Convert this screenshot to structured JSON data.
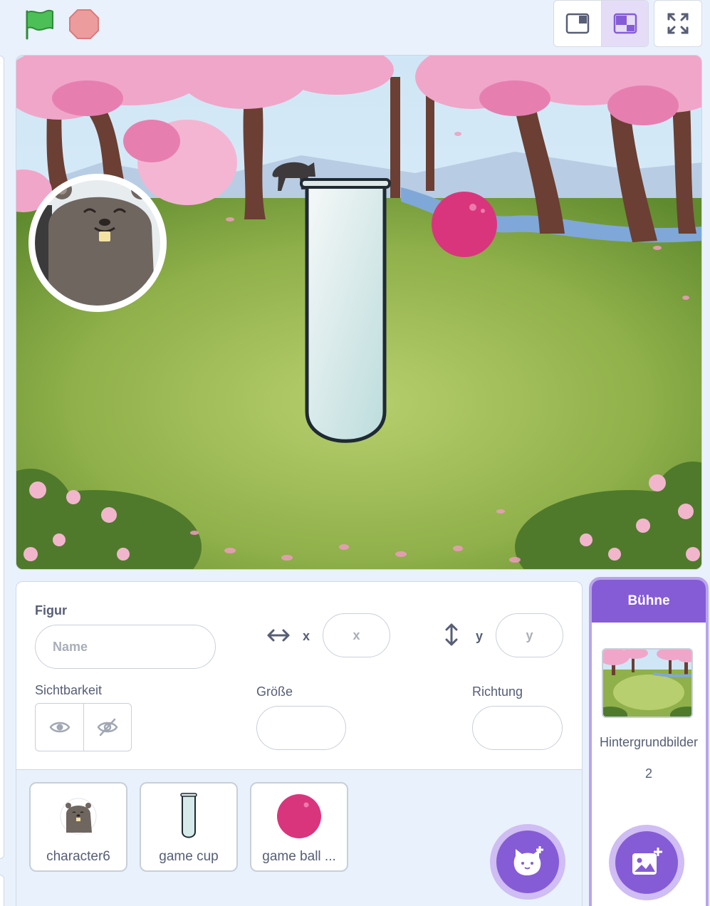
{
  "toolbar": {
    "green_flag": "green-flag-icon",
    "stop": "stop-icon",
    "small_stage_mode": "small-stage-icon",
    "normal_stage_mode": "normal-stage-icon",
    "fullscreen": "fullscreen-icon",
    "active_mode": "normal"
  },
  "stage": {
    "background": "cherry blossom forest",
    "sprites": [
      "character6",
      "game cup",
      "game ball"
    ]
  },
  "sprite_info": {
    "title": "Figur",
    "name_placeholder": "Name",
    "x_label": "x",
    "x_placeholder": "x",
    "y_label": "y",
    "y_placeholder": "y",
    "visibility_label": "Sichtbarkeit",
    "size_label": "Größe",
    "direction_label": "Richtung"
  },
  "sprite_list": [
    {
      "name": "character6",
      "icon": "beaver-icon"
    },
    {
      "name": "game cup",
      "icon": "cup-icon"
    },
    {
      "name": "game ball ...",
      "icon": "ball-icon"
    }
  ],
  "stage_selector": {
    "title": "Bühne",
    "backdrops_label": "Hintergrundbilder",
    "backdrops_count": "2"
  },
  "colors": {
    "accent": "#855cd6",
    "accent_light": "#cfbdf3",
    "ball": "#d9357d",
    "flag": "#4cbf56",
    "stop": "#ec9c9c"
  }
}
